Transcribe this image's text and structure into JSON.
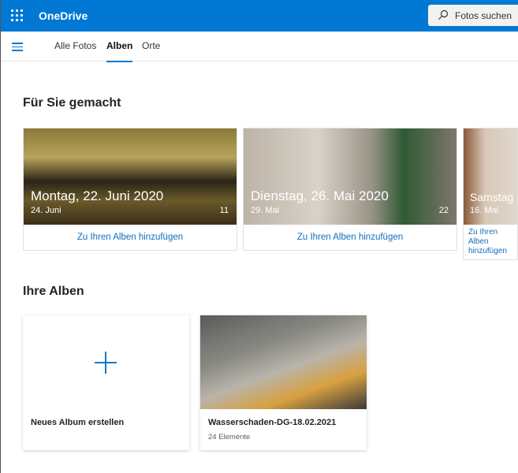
{
  "header": {
    "app_title": "OneDrive",
    "search_placeholder": "Fotos suchen"
  },
  "nav": {
    "tabs": [
      {
        "label": "Alle Fotos"
      },
      {
        "label": "Alben",
        "active": true
      },
      {
        "label": "Orte"
      }
    ]
  },
  "made_for_you": {
    "heading": "Für Sie gemacht",
    "cards": [
      {
        "title": "Montag, 22. Juni 2020",
        "subtitle": "24. Juni",
        "count": "11",
        "action": "Zu Ihren Alben hinzufügen"
      },
      {
        "title": "Dienstag, 26. Mai 2020",
        "subtitle": "29. Mai",
        "count": "22",
        "action": "Zu Ihren Alben hinzufügen"
      },
      {
        "title": "Samstag",
        "subtitle": "16. Mai",
        "count": "",
        "action": "Zu Ihren Alben hinzufügen"
      }
    ]
  },
  "your_albums": {
    "heading": "Ihre Alben",
    "new_album_label": "Neues Album erstellen",
    "albums": [
      {
        "name": "Wasserschaden-DG-18.02.2021",
        "items": "24 Elemente"
      }
    ]
  }
}
